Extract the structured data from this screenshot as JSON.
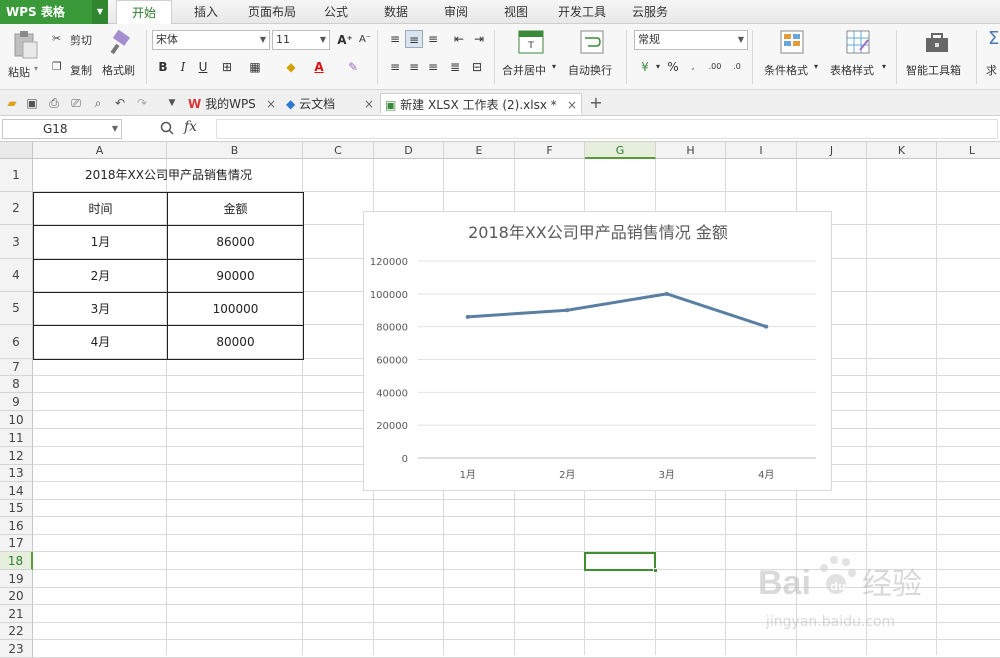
{
  "app": {
    "name": "WPS 表格"
  },
  "menu_tabs": [
    "开始",
    "插入",
    "页面布局",
    "公式",
    "数据",
    "审阅",
    "视图",
    "开发工具",
    "云服务"
  ],
  "ribbon": {
    "paste": "粘贴",
    "cut": "剪切",
    "copy": "复制",
    "format_painter": "格式刷",
    "font_name": "宋体",
    "font_size": "11",
    "merge_center": "合并居中",
    "wrap_text": "自动换行",
    "number_format": "常规",
    "percent": "%",
    "conditional_format": "条件格式",
    "table_style": "表格样式",
    "smart_toolbox": "智能工具箱",
    "sum_partial": "求"
  },
  "doc_tabs": [
    {
      "label": "我的WPS"
    },
    {
      "label": "云文档"
    },
    {
      "label": "新建 XLSX 工作表 (2).xlsx *"
    }
  ],
  "formula_bar": {
    "cell_ref": "G18",
    "fx": "fx",
    "value": ""
  },
  "columns": [
    "A",
    "B",
    "C",
    "D",
    "E",
    "F",
    "G",
    "H",
    "I",
    "J",
    "K",
    "L"
  ],
  "rows": [
    "1",
    "2",
    "3",
    "4",
    "5",
    "6",
    "7",
    "8",
    "9",
    "10",
    "11",
    "12",
    "13",
    "14",
    "15",
    "16",
    "17",
    "18",
    "19",
    "20",
    "21",
    "22",
    "23"
  ],
  "selected": {
    "column": "G",
    "row": "18"
  },
  "table": {
    "title": "2018年XX公司甲产品销售情况",
    "headers": [
      "时间",
      "金额"
    ],
    "rows": [
      [
        "1月",
        "86000"
      ],
      [
        "2月",
        "90000"
      ],
      [
        "3月",
        "100000"
      ],
      [
        "4月",
        "80000"
      ]
    ]
  },
  "chart_data": {
    "type": "line",
    "title": "2018年XX公司甲产品销售情况 金额",
    "categories": [
      "1月",
      "2月",
      "3月",
      "4月"
    ],
    "series": [
      {
        "values": [
          86000,
          90000,
          100000,
          80000
        ],
        "color": "#5a7fa3"
      }
    ],
    "ylim": [
      0,
      120000
    ],
    "yticks": [
      0,
      20000,
      40000,
      60000,
      80000,
      100000,
      120000
    ],
    "grid": true,
    "legend": "none"
  },
  "watermark": {
    "brand": "Bai",
    "brand2": "du",
    "product": "经验",
    "url": "jingyan.baidu.com"
  }
}
